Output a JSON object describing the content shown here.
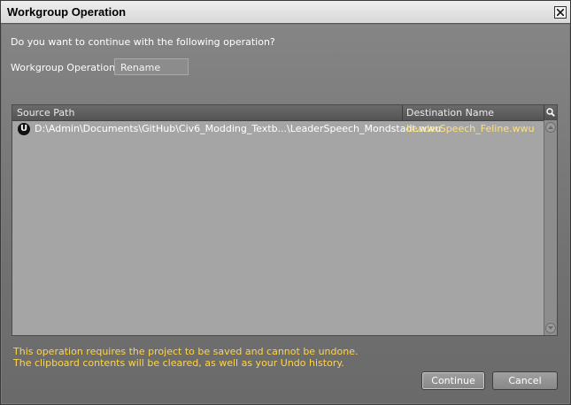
{
  "window": {
    "title": "Workgroup Operation"
  },
  "dialog": {
    "prompt": "Do you want to continue with the following operation?",
    "operation_label": "Workgroup Operation:",
    "operation_value": "Rename"
  },
  "list": {
    "columns": [
      "Source Path",
      "Destination Name"
    ],
    "rows": [
      {
        "icon": "wwise-unit-icon",
        "icon_letter": "U",
        "source_path": "D:\\Admin\\Documents\\GitHub\\Civ6_Modding_Textb...\\LeaderSpeech_Mondstadt.wwu",
        "destination_name": "LeaderSpeech_Feline.wwu"
      }
    ]
  },
  "warnings": [
    "This operation requires the project to be saved and cannot be undone.",
    "The clipboard contents will be cleared, as well as your Undo history."
  ],
  "buttons": {
    "continue": "Continue",
    "cancel": "Cancel"
  },
  "colors": {
    "warning_text": "#ffd54a",
    "destination_text": "#ffe07a"
  }
}
